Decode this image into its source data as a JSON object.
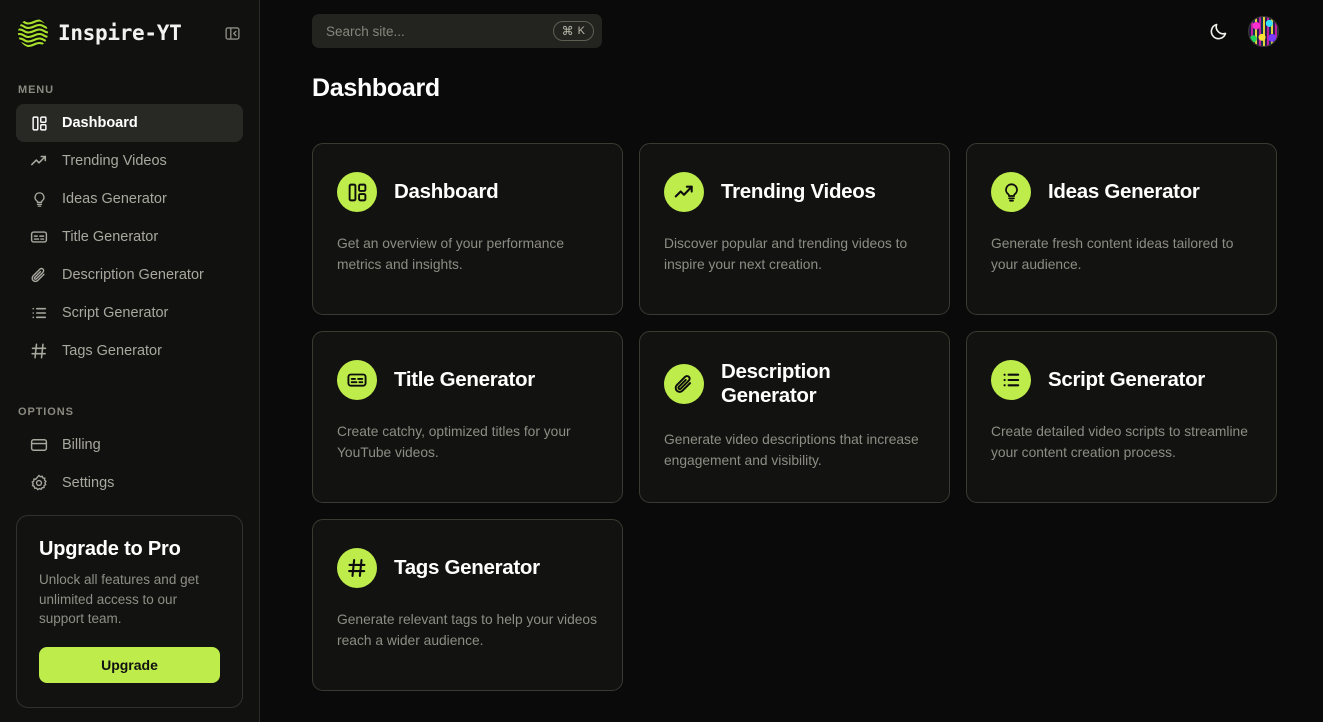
{
  "app": {
    "brand_name": "Inspire-YT",
    "logo_icon": "green-globe-waves-logo",
    "collapse_icon": "panel-collapse-icon"
  },
  "sidebar": {
    "menu_label": "MENU",
    "options_label": "OPTIONS",
    "menu_items": [
      {
        "label": "Dashboard",
        "icon": "layout-dashboard-icon",
        "active": true
      },
      {
        "label": "Trending Videos",
        "icon": "trending-up-icon",
        "active": false
      },
      {
        "label": "Ideas Generator",
        "icon": "lightbulb-icon",
        "active": false
      },
      {
        "label": "Title Generator",
        "icon": "captions-icon",
        "active": false
      },
      {
        "label": "Description Generator",
        "icon": "paperclip-icon",
        "active": false
      },
      {
        "label": "Script Generator",
        "icon": "list-icon",
        "active": false
      },
      {
        "label": "Tags Generator",
        "icon": "hash-icon",
        "active": false
      }
    ],
    "options_items": [
      {
        "label": "Billing",
        "icon": "credit-card-icon"
      },
      {
        "label": "Settings",
        "icon": "gear-icon"
      }
    ],
    "upgrade": {
      "title": "Upgrade to Pro",
      "description": "Unlock all features and get unlimited access to our support team.",
      "button_label": "Upgrade"
    }
  },
  "topbar": {
    "search_placeholder": "Search site...",
    "search_value": "",
    "shortcut_cmd": "⌘",
    "shortcut_key": "K",
    "theme_icon": "moon-icon",
    "avatar_icon": "user-avatar"
  },
  "main": {
    "page_title": "Dashboard",
    "cards": [
      {
        "title": "Dashboard",
        "description": "Get an overview of your performance metrics and insights.",
        "icon": "layout-dashboard-icon"
      },
      {
        "title": "Trending Videos",
        "description": "Discover popular and trending videos to inspire your next creation.",
        "icon": "trending-up-icon"
      },
      {
        "title": "Ideas Generator",
        "description": "Generate fresh content ideas tailored to your audience.",
        "icon": "lightbulb-icon"
      },
      {
        "title": "Title Generator",
        "description": "Create catchy, optimized titles for your YouTube videos.",
        "icon": "captions-icon"
      },
      {
        "title": "Description Generator",
        "description": "Generate video descriptions that increase engagement and visibility.",
        "icon": "paperclip-icon"
      },
      {
        "title": "Script Generator",
        "description": "Create detailed video scripts to streamline your content creation process.",
        "icon": "list-icon"
      },
      {
        "title": "Tags Generator",
        "description": "Generate relevant tags to help your videos reach a wider audience.",
        "icon": "hash-icon"
      }
    ]
  },
  "colors": {
    "accent_green": "#bdec4b",
    "page_background": "#0a0a0a",
    "sidebar_background": "#111110",
    "card_background": "#121211",
    "card_border": "#3a3a32",
    "active_item_background": "#282824",
    "muted_text": "#8d8d84"
  }
}
